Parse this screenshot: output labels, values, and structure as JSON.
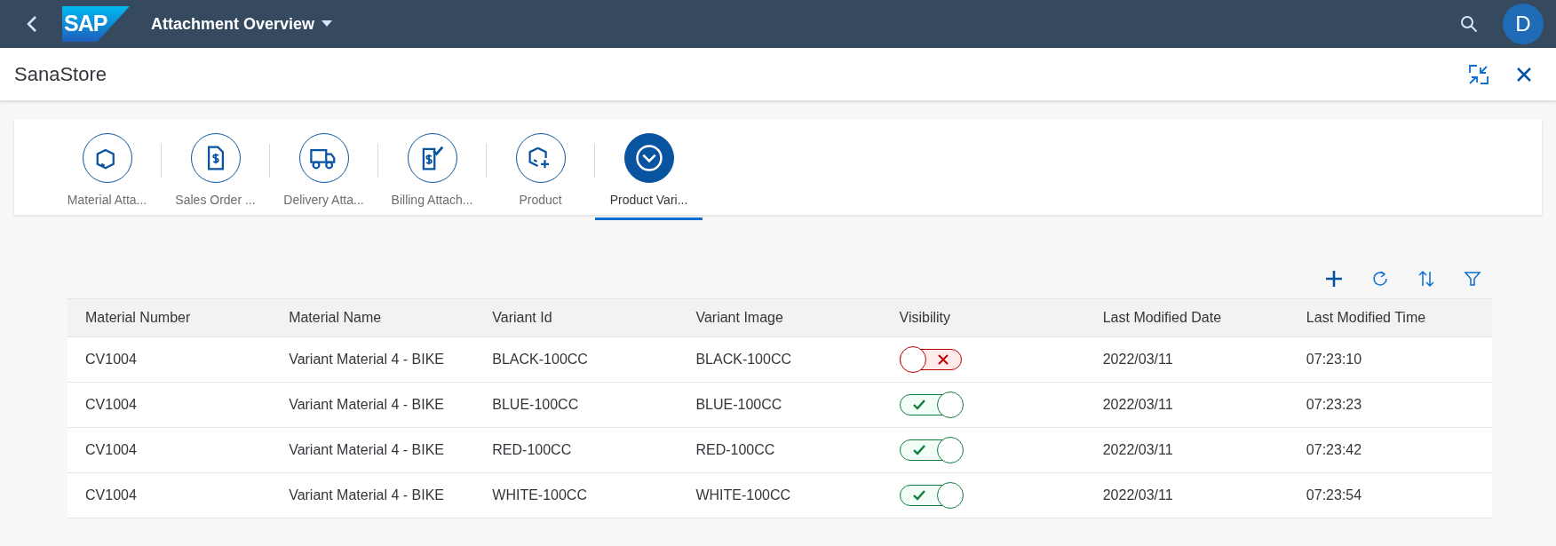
{
  "shell": {
    "logo_text": "SAP",
    "title": "Attachment Overview",
    "avatar": "D"
  },
  "page": {
    "title": "SanaStore"
  },
  "tabs": [
    {
      "label": "Material Atta...",
      "kind": "box",
      "selected": false
    },
    {
      "label": "Sales Order ...",
      "kind": "invoice",
      "selected": false
    },
    {
      "label": "Delivery Atta...",
      "kind": "truck",
      "selected": false
    },
    {
      "label": "Billing Attach...",
      "kind": "billing",
      "selected": false
    },
    {
      "label": "Product",
      "kind": "boxadd",
      "selected": false
    },
    {
      "label": "Product Vari...",
      "kind": "chevron",
      "selected": true
    }
  ],
  "table": {
    "columns": [
      "Material Number",
      "Material Name",
      "Variant Id",
      "Variant Image",
      "Visibility",
      "Last Modified Date",
      "Last Modified Time"
    ],
    "rows": [
      {
        "material_number": "CV1004",
        "material_name": "Variant Material 4 - BIKE",
        "variant_id": "BLACK-100CC",
        "variant_image": "BLACK-100CC",
        "visible": false,
        "date": "2022/03/11",
        "time": "07:23:10"
      },
      {
        "material_number": "CV1004",
        "material_name": "Variant Material 4 - BIKE",
        "variant_id": "BLUE-100CC",
        "variant_image": "BLUE-100CC",
        "visible": true,
        "date": "2022/03/11",
        "time": "07:23:23"
      },
      {
        "material_number": "CV1004",
        "material_name": "Variant Material 4 - BIKE",
        "variant_id": "RED-100CC",
        "variant_image": "RED-100CC",
        "visible": true,
        "date": "2022/03/11",
        "time": "07:23:42"
      },
      {
        "material_number": "CV1004",
        "material_name": "Variant Material 4 - BIKE",
        "variant_id": "WHITE-100CC",
        "variant_image": "WHITE-100CC",
        "visible": true,
        "date": "2022/03/11",
        "time": "07:23:54"
      }
    ]
  }
}
